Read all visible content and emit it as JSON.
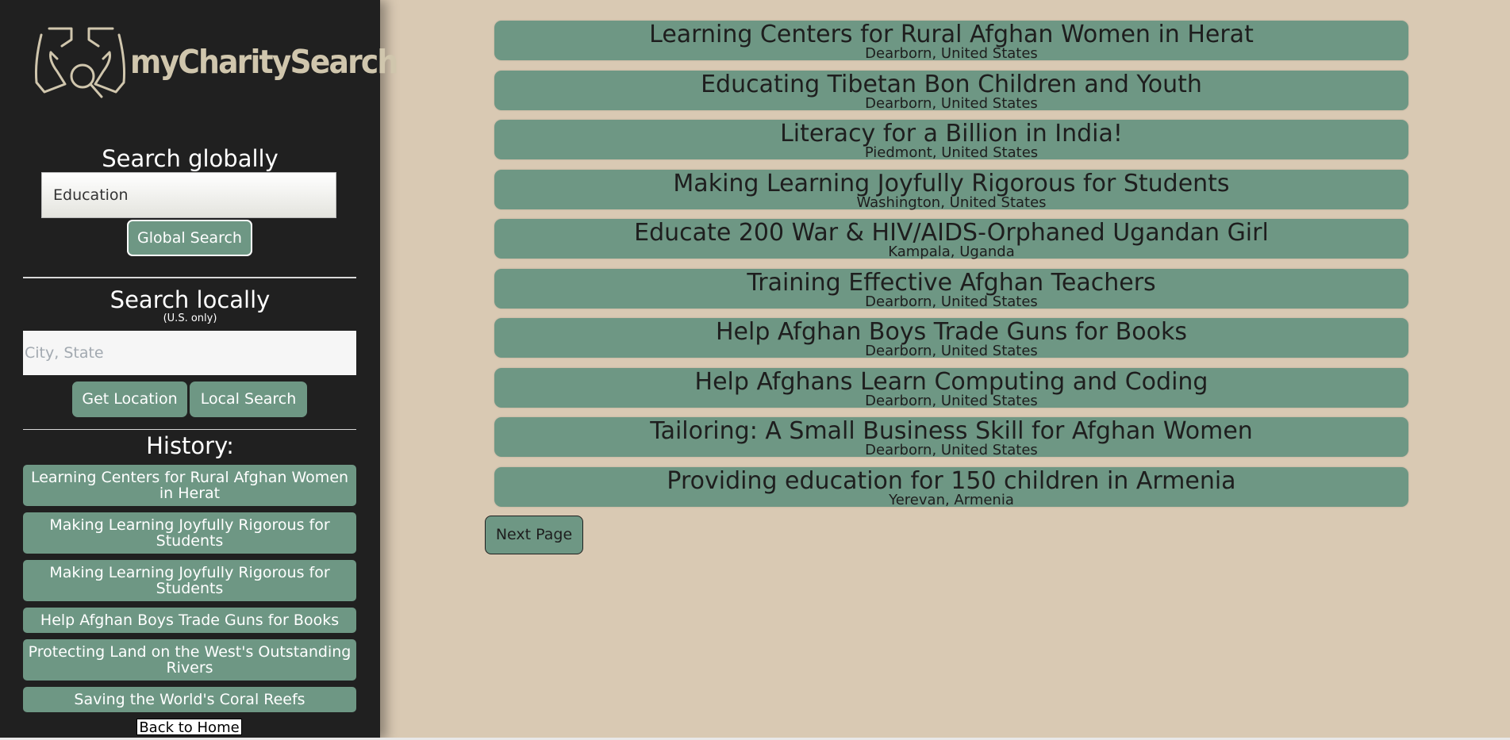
{
  "brand": {
    "logo_text": "myCharitySearch",
    "logo_color": "#d0c6ad"
  },
  "colors": {
    "sidebar_bg": "#202020",
    "page_bg": "#d9c9b3",
    "accent_green": "#6e9784"
  },
  "sidebar": {
    "global_heading": "Search globally",
    "global_input_value": "Education",
    "global_button": "Global Search",
    "local_heading": "Search locally",
    "local_subheading": "(U.S. only)",
    "local_input_placeholder": "City, State",
    "get_location_button": "Get Location",
    "local_search_button": "Local Search",
    "history_heading": "History:",
    "history": [
      "Learning Centers for Rural Afghan Women in Herat",
      "Making Learning Joyfully Rigorous for Students",
      "Making Learning Joyfully Rigorous for Students",
      "Help Afghan Boys Trade Guns for Books",
      "Protecting Land on the West's Outstanding Rivers",
      "Saving the World's Coral Reefs"
    ],
    "back_home": "Back to Home"
  },
  "results": [
    {
      "title": "Learning Centers for Rural Afghan Women in Herat",
      "location": "Dearborn, United States"
    },
    {
      "title": "Educating Tibetan Bon Children and Youth",
      "location": "Dearborn, United States"
    },
    {
      "title": "Literacy for a Billion in India!",
      "location": "Piedmont, United States"
    },
    {
      "title": "Making Learning Joyfully Rigorous for Students",
      "location": "Washington, United States"
    },
    {
      "title": "Educate 200 War & HIV/AIDS-Orphaned Ugandan Girl",
      "location": "Kampala, Uganda"
    },
    {
      "title": "Training Effective Afghan Teachers",
      "location": "Dearborn, United States"
    },
    {
      "title": "Help Afghan Boys Trade Guns for Books",
      "location": "Dearborn, United States"
    },
    {
      "title": "Help Afghans Learn Computing and Coding",
      "location": "Dearborn, United States"
    },
    {
      "title": "Tailoring: A Small Business Skill for Afghan Women",
      "location": "Dearborn, United States"
    },
    {
      "title": "Providing education for 150 children in Armenia",
      "location": "Yerevan, Armenia"
    }
  ],
  "next_page_button": "Next Page"
}
